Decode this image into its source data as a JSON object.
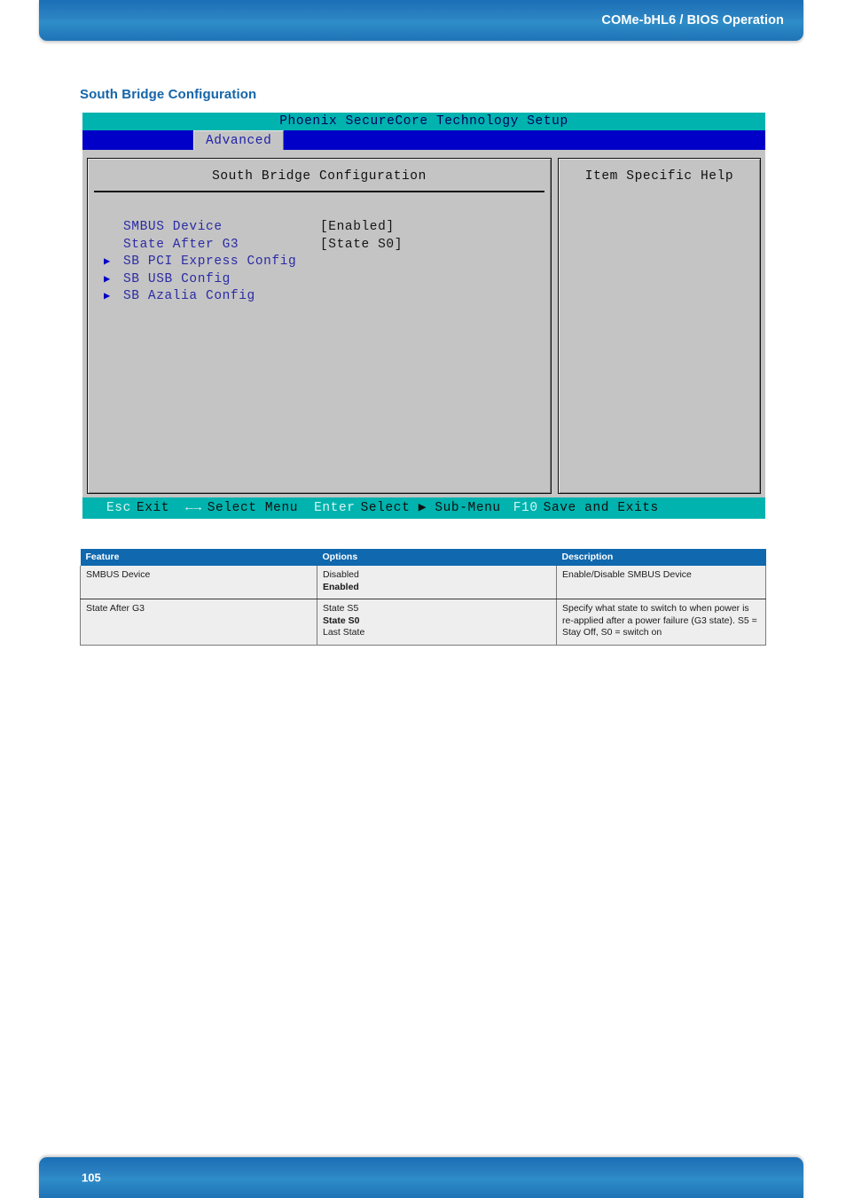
{
  "header": {
    "title": "COMe-bHL6 / BIOS Operation"
  },
  "section": {
    "title": "South Bridge Configuration"
  },
  "bios": {
    "titlebar": "Phoenix SecureCore Technology Setup",
    "active_tab": "Advanced",
    "left_pane_title": "South Bridge Configuration",
    "right_pane_title": "Item Specific Help",
    "items": [
      {
        "arrow": "",
        "label": "SMBUS Device",
        "value": "[Enabled]"
      },
      {
        "arrow": "",
        "label": "State After G3",
        "value": "[State S0]"
      },
      {
        "arrow": "▶",
        "label": "SB PCI Express Config",
        "value": ""
      },
      {
        "arrow": "▶",
        "label": "SB USB Config",
        "value": ""
      },
      {
        "arrow": "▶",
        "label": "SB Azalia Config",
        "value": ""
      }
    ],
    "footer": {
      "esc_key": "Esc",
      "esc_action": "Exit",
      "arrow_key": "←→",
      "arrow_action": "Select Menu",
      "enter_key": "Enter",
      "enter_action": "Select ▶ Sub-Menu",
      "f10_key": "F10",
      "f10_action": "Save and Exits"
    }
  },
  "table": {
    "headers": {
      "feature": "Feature",
      "options": "Options",
      "description": "Description"
    },
    "rows": [
      {
        "feature": "SMBUS Device",
        "options": [
          {
            "text": "Disabled",
            "bold": false
          },
          {
            "text": "Enabled",
            "bold": true
          }
        ],
        "description": "Enable/Disable SMBUS Device"
      },
      {
        "feature": "State After G3",
        "options": [
          {
            "text": "State S5",
            "bold": false
          },
          {
            "text": "State S0",
            "bold": true
          },
          {
            "text": "Last State",
            "bold": false
          }
        ],
        "description": "Specify what state to switch to when power is re-applied after a power failure (G3 state). S5 = Stay Off, S0 = switch on"
      }
    ]
  },
  "footer": {
    "page_number": "105"
  },
  "colors": {
    "brand_blue": "#1068ae",
    "bios_teal": "#00b3ae",
    "bios_menu_blue": "#0000c8",
    "bios_gray": "#c4c4c4",
    "label_blue": "#2b2ba5"
  }
}
